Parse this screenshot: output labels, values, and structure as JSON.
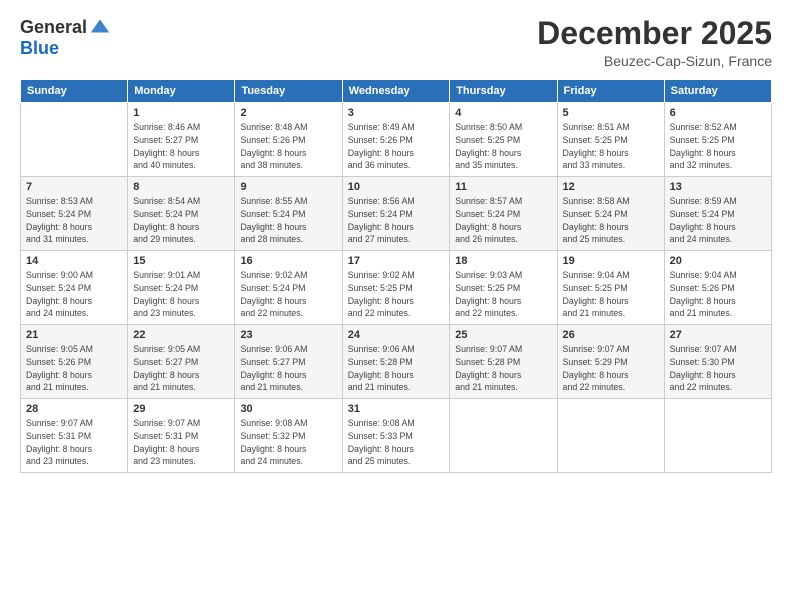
{
  "logo": {
    "general": "General",
    "blue": "Blue"
  },
  "title": "December 2025",
  "location": "Beuzec-Cap-Sizun, France",
  "days_header": [
    "Sunday",
    "Monday",
    "Tuesday",
    "Wednesday",
    "Thursday",
    "Friday",
    "Saturday"
  ],
  "weeks": [
    [
      {
        "day": "",
        "detail": ""
      },
      {
        "day": "1",
        "detail": "Sunrise: 8:46 AM\nSunset: 5:27 PM\nDaylight: 8 hours\nand 40 minutes."
      },
      {
        "day": "2",
        "detail": "Sunrise: 8:48 AM\nSunset: 5:26 PM\nDaylight: 8 hours\nand 38 minutes."
      },
      {
        "day": "3",
        "detail": "Sunrise: 8:49 AM\nSunset: 5:26 PM\nDaylight: 8 hours\nand 36 minutes."
      },
      {
        "day": "4",
        "detail": "Sunrise: 8:50 AM\nSunset: 5:25 PM\nDaylight: 8 hours\nand 35 minutes."
      },
      {
        "day": "5",
        "detail": "Sunrise: 8:51 AM\nSunset: 5:25 PM\nDaylight: 8 hours\nand 33 minutes."
      },
      {
        "day": "6",
        "detail": "Sunrise: 8:52 AM\nSunset: 5:25 PM\nDaylight: 8 hours\nand 32 minutes."
      }
    ],
    [
      {
        "day": "7",
        "detail": "Sunrise: 8:53 AM\nSunset: 5:24 PM\nDaylight: 8 hours\nand 31 minutes."
      },
      {
        "day": "8",
        "detail": "Sunrise: 8:54 AM\nSunset: 5:24 PM\nDaylight: 8 hours\nand 29 minutes."
      },
      {
        "day": "9",
        "detail": "Sunrise: 8:55 AM\nSunset: 5:24 PM\nDaylight: 8 hours\nand 28 minutes."
      },
      {
        "day": "10",
        "detail": "Sunrise: 8:56 AM\nSunset: 5:24 PM\nDaylight: 8 hours\nand 27 minutes."
      },
      {
        "day": "11",
        "detail": "Sunrise: 8:57 AM\nSunset: 5:24 PM\nDaylight: 8 hours\nand 26 minutes."
      },
      {
        "day": "12",
        "detail": "Sunrise: 8:58 AM\nSunset: 5:24 PM\nDaylight: 8 hours\nand 25 minutes."
      },
      {
        "day": "13",
        "detail": "Sunrise: 8:59 AM\nSunset: 5:24 PM\nDaylight: 8 hours\nand 24 minutes."
      }
    ],
    [
      {
        "day": "14",
        "detail": "Sunrise: 9:00 AM\nSunset: 5:24 PM\nDaylight: 8 hours\nand 24 minutes."
      },
      {
        "day": "15",
        "detail": "Sunrise: 9:01 AM\nSunset: 5:24 PM\nDaylight: 8 hours\nand 23 minutes."
      },
      {
        "day": "16",
        "detail": "Sunrise: 9:02 AM\nSunset: 5:24 PM\nDaylight: 8 hours\nand 22 minutes."
      },
      {
        "day": "17",
        "detail": "Sunrise: 9:02 AM\nSunset: 5:25 PM\nDaylight: 8 hours\nand 22 minutes."
      },
      {
        "day": "18",
        "detail": "Sunrise: 9:03 AM\nSunset: 5:25 PM\nDaylight: 8 hours\nand 22 minutes."
      },
      {
        "day": "19",
        "detail": "Sunrise: 9:04 AM\nSunset: 5:25 PM\nDaylight: 8 hours\nand 21 minutes."
      },
      {
        "day": "20",
        "detail": "Sunrise: 9:04 AM\nSunset: 5:26 PM\nDaylight: 8 hours\nand 21 minutes."
      }
    ],
    [
      {
        "day": "21",
        "detail": "Sunrise: 9:05 AM\nSunset: 5:26 PM\nDaylight: 8 hours\nand 21 minutes."
      },
      {
        "day": "22",
        "detail": "Sunrise: 9:05 AM\nSunset: 5:27 PM\nDaylight: 8 hours\nand 21 minutes."
      },
      {
        "day": "23",
        "detail": "Sunrise: 9:06 AM\nSunset: 5:27 PM\nDaylight: 8 hours\nand 21 minutes."
      },
      {
        "day": "24",
        "detail": "Sunrise: 9:06 AM\nSunset: 5:28 PM\nDaylight: 8 hours\nand 21 minutes."
      },
      {
        "day": "25",
        "detail": "Sunrise: 9:07 AM\nSunset: 5:28 PM\nDaylight: 8 hours\nand 21 minutes."
      },
      {
        "day": "26",
        "detail": "Sunrise: 9:07 AM\nSunset: 5:29 PM\nDaylight: 8 hours\nand 22 minutes."
      },
      {
        "day": "27",
        "detail": "Sunrise: 9:07 AM\nSunset: 5:30 PM\nDaylight: 8 hours\nand 22 minutes."
      }
    ],
    [
      {
        "day": "28",
        "detail": "Sunrise: 9:07 AM\nSunset: 5:31 PM\nDaylight: 8 hours\nand 23 minutes."
      },
      {
        "day": "29",
        "detail": "Sunrise: 9:07 AM\nSunset: 5:31 PM\nDaylight: 8 hours\nand 23 minutes."
      },
      {
        "day": "30",
        "detail": "Sunrise: 9:08 AM\nSunset: 5:32 PM\nDaylight: 8 hours\nand 24 minutes."
      },
      {
        "day": "31",
        "detail": "Sunrise: 9:08 AM\nSunset: 5:33 PM\nDaylight: 8 hours\nand 25 minutes."
      },
      {
        "day": "",
        "detail": ""
      },
      {
        "day": "",
        "detail": ""
      },
      {
        "day": "",
        "detail": ""
      }
    ]
  ]
}
